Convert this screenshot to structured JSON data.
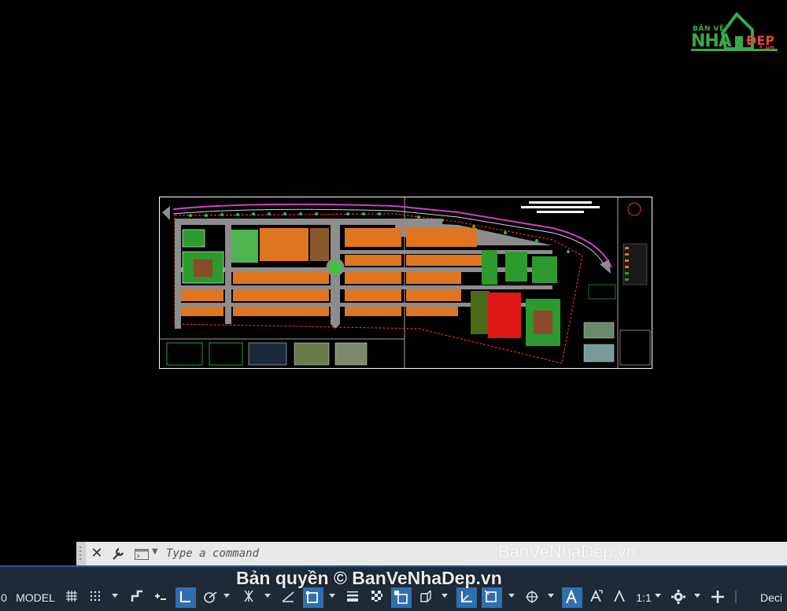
{
  "watermark": {
    "logo_top": "BẢN VẼ",
    "logo_main": "NHÀ",
    "logo_dep": "ĐẸP",
    "logo_vn": ".vn",
    "center_text": "BanVeNhaDep.vn",
    "bottom_text": "Bản quyền © BanVeNhaDep.vn"
  },
  "command_line": {
    "placeholder": "Type a command"
  },
  "statusbar": {
    "left_digit": "0",
    "model_label": "MODEL",
    "scale_label": "1:1",
    "units_label": "Deci"
  },
  "colors": {
    "background": "#000000",
    "command_bar": "#e8e8e8",
    "status_bar": "#1f2a37",
    "active_toggle": "#2f6fb0"
  }
}
